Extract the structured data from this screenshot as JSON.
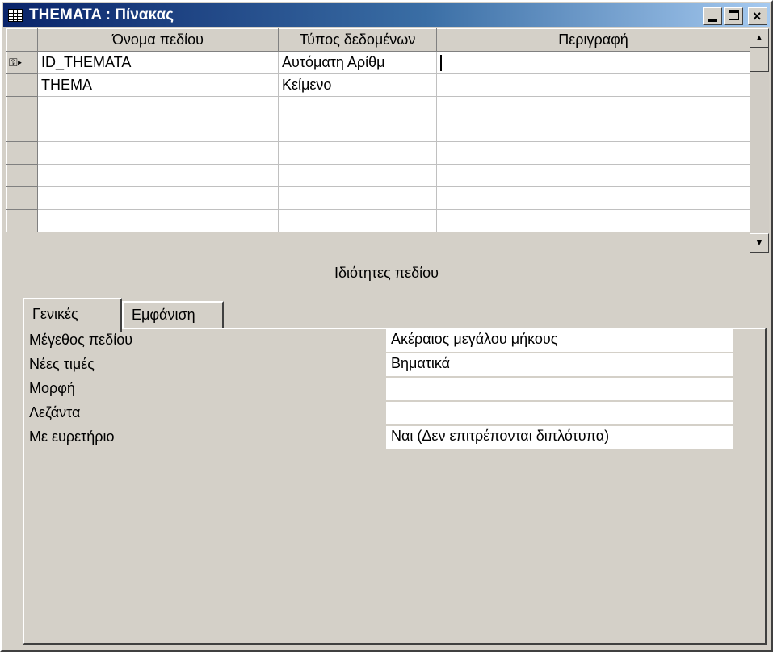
{
  "window": {
    "title": "THEMATA : Πίνακας",
    "controls": {
      "minimize": "_",
      "maximize": "□",
      "close": "×"
    }
  },
  "grid": {
    "columns": [
      "Όνομα πεδίου",
      "Τύπος δεδομένων",
      "Περιγραφή"
    ],
    "rows": [
      {
        "field_name": "ID_THEMATA",
        "data_type": "Αυτόματη Αρίθμ",
        "description": "",
        "primary_key": true,
        "current": true
      },
      {
        "field_name": "THEMA",
        "data_type": "Κείμενο",
        "description": ""
      },
      {
        "field_name": "",
        "data_type": "",
        "description": ""
      },
      {
        "field_name": "",
        "data_type": "",
        "description": ""
      },
      {
        "field_name": "",
        "data_type": "",
        "description": ""
      },
      {
        "field_name": "",
        "data_type": "",
        "description": ""
      },
      {
        "field_name": "",
        "data_type": "",
        "description": ""
      },
      {
        "field_name": "",
        "data_type": "",
        "description": ""
      }
    ],
    "row_marker": {
      "key_icon": "key-icon",
      "current_icon": "triangle-right-icon"
    }
  },
  "properties": {
    "header": "Ιδιότητες πεδίου",
    "tabs": [
      {
        "label": "Γενικές",
        "active": true
      },
      {
        "label": "Εμφάνιση",
        "active": false
      }
    ],
    "items": [
      {
        "label": "Μέγεθος πεδίου",
        "value": "Ακέραιος μεγάλου μήκους"
      },
      {
        "label": "Νέες τιμές",
        "value": "Βηματικά"
      },
      {
        "label": "Μορφή",
        "value": ""
      },
      {
        "label": "Λεζάντα",
        "value": ""
      },
      {
        "label": "Με ευρετήριο",
        "value": "Ναι (Δεν επιτρέπονται διπλότυπα)"
      }
    ]
  }
}
